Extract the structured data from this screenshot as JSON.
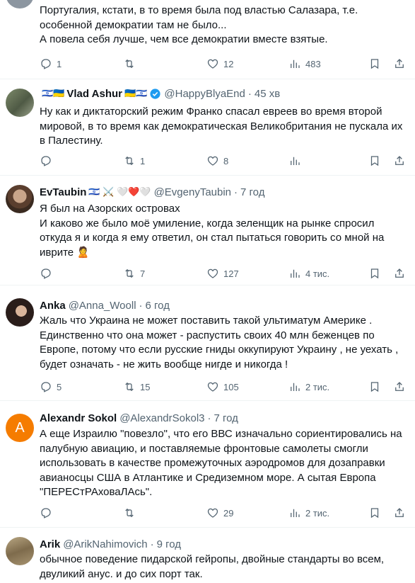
{
  "tweets": [
    {
      "name": "",
      "handle": "",
      "time": "",
      "body": [
        "Португалия, кстати, в то время была под властью Салазара, т.е.",
        "особенной демократии там не было...",
        "А повела себя лучше, чем все демократии вместе взятые."
      ],
      "reply": "1",
      "retweet": "",
      "like": "12",
      "views": "483"
    },
    {
      "name": "Vlad Ashur",
      "handle": "@HappyBlyaEnd",
      "time": "45 хв",
      "body": [
        "Ну как и диктаторский режим Франко спасал евреев во время второй",
        "мировой, в то время как демократическая Великобритания не пускала их",
        "в Палестину."
      ],
      "reply": "",
      "retweet": "1",
      "like": "8",
      "views": ""
    },
    {
      "name": "EvTaubin",
      "handle": "@EvgenyTaubin",
      "time": "7 год",
      "body": [
        "Я был на Азорских островах",
        "И каково же было моё умиление, когда зеленщик на рынке спросил",
        "откуда я и когда я ему ответил, он стал пытаться говорить со мной на",
        "иврите 🙎"
      ],
      "reply": "",
      "retweet": "7",
      "like": "127",
      "views": "4 тис."
    },
    {
      "name": "Anka",
      "handle": "@Anna_Wooll",
      "time": "6 год",
      "body": [
        "Жаль что Украина не может поставить такой ультиматум  Америке .",
        "Единственно что она может - распустить своих 40 млн беженцев по",
        "Европе, потому что если русские гниды оккупируют Украину , не уехать ,",
        "будет означать - не жить вообще нигде  и никогда !"
      ],
      "reply": "5",
      "retweet": "15",
      "like": "105",
      "views": "2 тис."
    },
    {
      "name": "Alexandr Sokol",
      "handle": "@AlexandrSokol3",
      "time": "7 год",
      "avatar_letter": "A",
      "body": [
        "А еще Израилю \"повезло\", что его ВВС изначально сориентировались на",
        "палубную авиацию, и поставляемые фронтовые самолеты смогли",
        "использовать в качестве промежуточных аэродромов для дозаправки",
        "авианосцы США в Атлантике и Средиземном море. А сытая Европа",
        "\"ПЕРЕСтРАховаЛАсь\"."
      ],
      "reply": "",
      "retweet": "",
      "like": "29",
      "views": "2 тис."
    },
    {
      "name": "Arik",
      "handle": "@ArikNahimovich",
      "time": "9 год",
      "body": [
        "обычное поведение пидарской гейропы, двойные стандарты во всем,",
        "двуликий анус. и до сих порт так."
      ],
      "reply": "",
      "retweet": "",
      "like": "",
      "views": ""
    }
  ],
  "colors": {
    "accent": "#1d9bf0",
    "muted": "#536471",
    "text": "#0f1419",
    "sokol_avatar": "#f57c00"
  },
  "icons": [
    "reply-icon",
    "retweet-icon",
    "like-icon",
    "views-icon",
    "bookmark-icon",
    "share-icon",
    "verified-icon"
  ]
}
